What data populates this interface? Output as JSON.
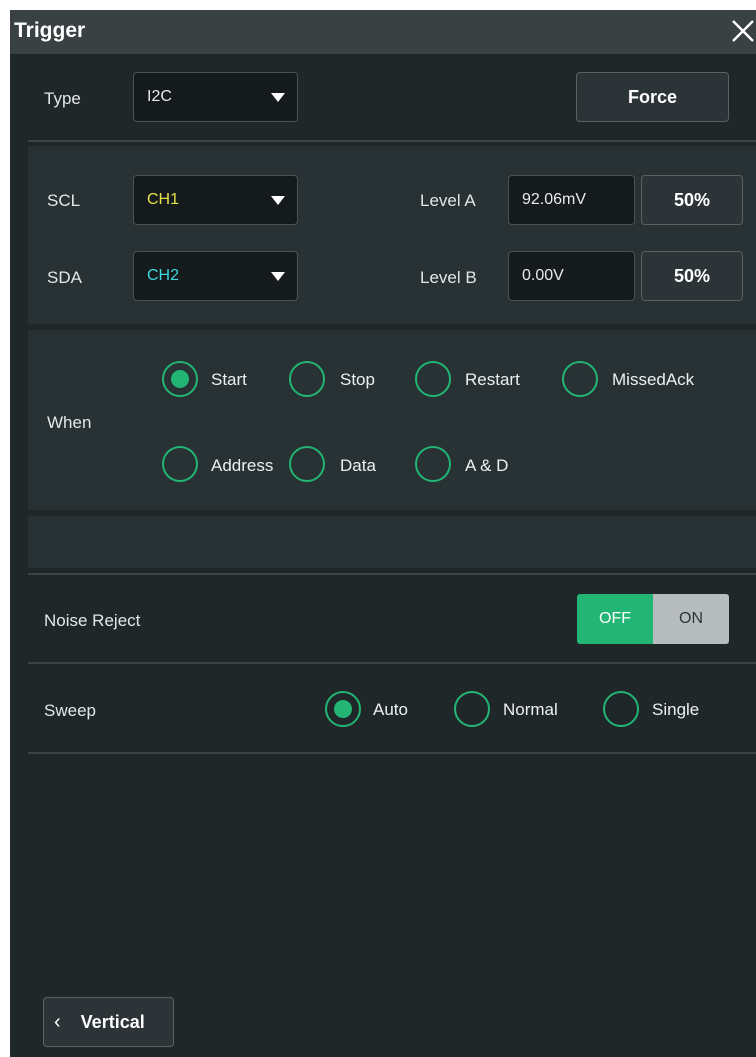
{
  "window": {
    "title": "Trigger"
  },
  "type_row": {
    "label": "Type",
    "value": "I2C",
    "force_label": "Force"
  },
  "source": {
    "scl_label": "SCL",
    "scl_value": "CH1",
    "scl_color": "#e8e24a",
    "sda_label": "SDA",
    "sda_value": "CH2",
    "sda_color": "#3ed6e0",
    "level_a_label": "Level A",
    "level_a_value": "92.06mV",
    "level_a_pct": "50%",
    "level_b_label": "Level B",
    "level_b_value": "0.00V",
    "level_b_pct": "50%"
  },
  "when": {
    "label": "When",
    "options": [
      "Start",
      "Stop",
      "Restart",
      "MissedAck",
      "Address",
      "Data",
      "A & D"
    ],
    "selected": "Start"
  },
  "noise_reject": {
    "label": "Noise Reject",
    "off_label": "OFF",
    "on_label": "ON",
    "state": "OFF"
  },
  "sweep": {
    "label": "Sweep",
    "options": [
      "Auto",
      "Normal",
      "Single"
    ],
    "selected": "Auto"
  },
  "footer": {
    "back_label": "Vertical"
  },
  "colors": {
    "accent": "#22b573",
    "panel": "#202729",
    "section": "#283134"
  }
}
